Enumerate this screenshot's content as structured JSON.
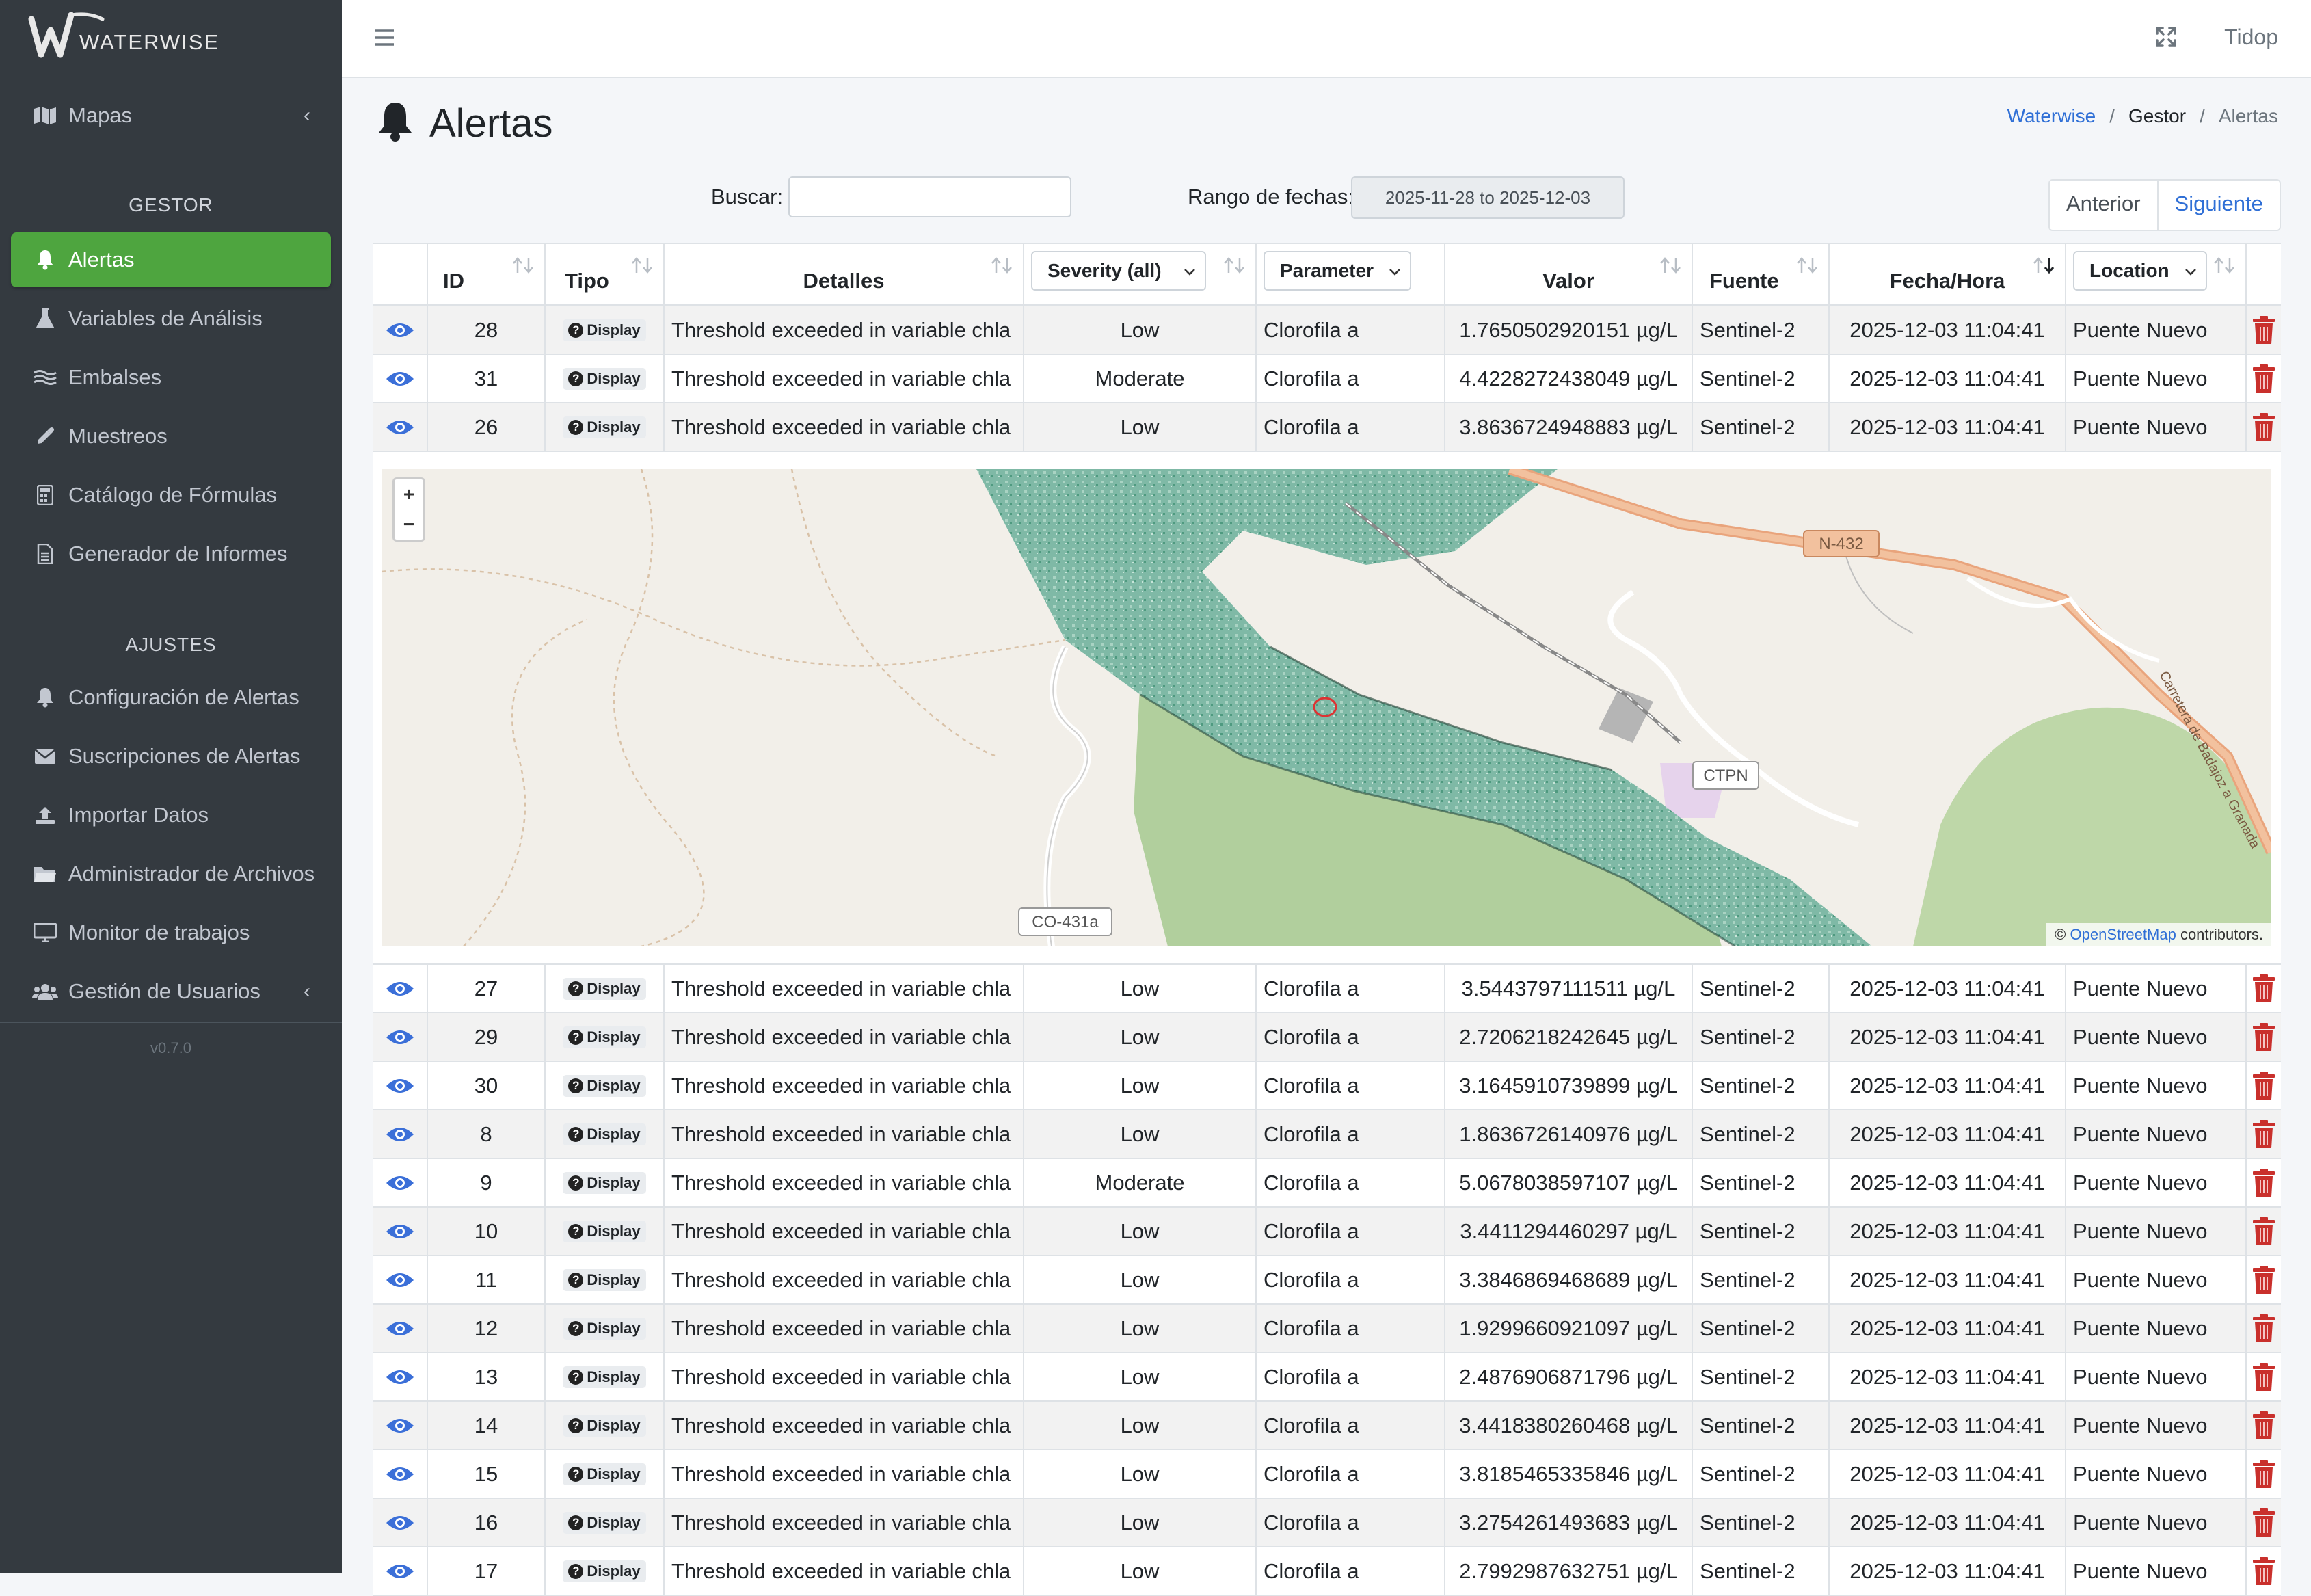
{
  "brand": {
    "logo_text": "WATERWISE"
  },
  "sidebar": {
    "sections": [
      {
        "header": "",
        "items": [
          {
            "label": "Mapas",
            "icon": "map-icon",
            "expandable": true
          }
        ]
      },
      {
        "header": "GESTOR",
        "items": [
          {
            "label": "Alertas",
            "icon": "bell-icon",
            "active": true
          },
          {
            "label": "Variables de Análisis",
            "icon": "flask-icon"
          },
          {
            "label": "Embalses",
            "icon": "water-icon"
          },
          {
            "label": "Muestreos",
            "icon": "eyedropper-icon"
          },
          {
            "label": "Catálogo de Fórmulas",
            "icon": "calculator-icon"
          },
          {
            "label": "Generador de Informes",
            "icon": "file-icon"
          }
        ]
      },
      {
        "header": "AJUSTES",
        "items": [
          {
            "label": "Configuración de Alertas",
            "icon": "bell-icon"
          },
          {
            "label": "Suscripciones de Alertas",
            "icon": "envelope-icon"
          },
          {
            "label": "Importar Datos",
            "icon": "upload-icon"
          },
          {
            "label": "Administrador de Archivos",
            "icon": "folder-icon"
          },
          {
            "label": "Monitor de trabajos",
            "icon": "monitor-icon"
          },
          {
            "label": "Gestión de Usuarios",
            "icon": "users-icon",
            "expandable": true
          }
        ]
      }
    ],
    "version": "v0.7.0"
  },
  "topbar": {
    "user": "Tidop"
  },
  "page": {
    "title": "Alertas",
    "breadcrumb": [
      "Waterwise",
      "Gestor",
      "Alertas"
    ]
  },
  "filters": {
    "search_label": "Buscar:",
    "search_value": "",
    "range_label": "Rango de fechas:",
    "range_value": "2025-11-28 to 2025-12-03"
  },
  "pagination": {
    "prev": "Anterior",
    "next": "Siguiente"
  },
  "table": {
    "headers": {
      "id": "ID",
      "tipo": "Tipo",
      "detalles": "Detalles",
      "severity": "Severity (all)",
      "parameter": "Parameter",
      "valor": "Valor",
      "fuente": "Fuente",
      "fecha": "Fecha/Hora",
      "location": "Location"
    },
    "badge_label": "Display",
    "rows_before_map": [
      {
        "id": "28",
        "detalles": "Threshold exceeded in variable chla",
        "severity": "Low",
        "parameter": "Clorofila a",
        "valor": "1.7650502920151 µg/L",
        "fuente": "Sentinel-2",
        "fecha": "2025-12-03 11:04:41",
        "location": "Puente Nuevo"
      },
      {
        "id": "31",
        "detalles": "Threshold exceeded in variable chla",
        "severity": "Moderate",
        "parameter": "Clorofila a",
        "valor": "4.4228272438049 µg/L",
        "fuente": "Sentinel-2",
        "fecha": "2025-12-03 11:04:41",
        "location": "Puente Nuevo"
      },
      {
        "id": "26",
        "detalles": "Threshold exceeded in variable chla",
        "severity": "Low",
        "parameter": "Clorofila a",
        "valor": "3.8636724948883 µg/L",
        "fuente": "Sentinel-2",
        "fecha": "2025-12-03 11:04:41",
        "location": "Puente Nuevo"
      }
    ],
    "rows_after_map": [
      {
        "id": "27",
        "detalles": "Threshold exceeded in variable chla",
        "severity": "Low",
        "parameter": "Clorofila a",
        "valor": "3.5443797111511 µg/L",
        "fuente": "Sentinel-2",
        "fecha": "2025-12-03 11:04:41",
        "location": "Puente Nuevo"
      },
      {
        "id": "29",
        "detalles": "Threshold exceeded in variable chla",
        "severity": "Low",
        "parameter": "Clorofila a",
        "valor": "2.7206218242645 µg/L",
        "fuente": "Sentinel-2",
        "fecha": "2025-12-03 11:04:41",
        "location": "Puente Nuevo"
      },
      {
        "id": "30",
        "detalles": "Threshold exceeded in variable chla",
        "severity": "Low",
        "parameter": "Clorofila a",
        "valor": "3.1645910739899 µg/L",
        "fuente": "Sentinel-2",
        "fecha": "2025-12-03 11:04:41",
        "location": "Puente Nuevo"
      },
      {
        "id": "8",
        "detalles": "Threshold exceeded in variable chla",
        "severity": "Low",
        "parameter": "Clorofila a",
        "valor": "1.8636726140976 µg/L",
        "fuente": "Sentinel-2",
        "fecha": "2025-12-03 11:04:41",
        "location": "Puente Nuevo"
      },
      {
        "id": "9",
        "detalles": "Threshold exceeded in variable chla",
        "severity": "Moderate",
        "parameter": "Clorofila a",
        "valor": "5.0678038597107 µg/L",
        "fuente": "Sentinel-2",
        "fecha": "2025-12-03 11:04:41",
        "location": "Puente Nuevo"
      },
      {
        "id": "10",
        "detalles": "Threshold exceeded in variable chla",
        "severity": "Low",
        "parameter": "Clorofila a",
        "valor": "3.4411294460297 µg/L",
        "fuente": "Sentinel-2",
        "fecha": "2025-12-03 11:04:41",
        "location": "Puente Nuevo"
      },
      {
        "id": "11",
        "detalles": "Threshold exceeded in variable chla",
        "severity": "Low",
        "parameter": "Clorofila a",
        "valor": "3.3846869468689 µg/L",
        "fuente": "Sentinel-2",
        "fecha": "2025-12-03 11:04:41",
        "location": "Puente Nuevo"
      },
      {
        "id": "12",
        "detalles": "Threshold exceeded in variable chla",
        "severity": "Low",
        "parameter": "Clorofila a",
        "valor": "1.9299660921097 µg/L",
        "fuente": "Sentinel-2",
        "fecha": "2025-12-03 11:04:41",
        "location": "Puente Nuevo"
      },
      {
        "id": "13",
        "detalles": "Threshold exceeded in variable chla",
        "severity": "Low",
        "parameter": "Clorofila a",
        "valor": "2.4876906871796 µg/L",
        "fuente": "Sentinel-2",
        "fecha": "2025-12-03 11:04:41",
        "location": "Puente Nuevo"
      },
      {
        "id": "14",
        "detalles": "Threshold exceeded in variable chla",
        "severity": "Low",
        "parameter": "Clorofila a",
        "valor": "3.4418380260468 µg/L",
        "fuente": "Sentinel-2",
        "fecha": "2025-12-03 11:04:41",
        "location": "Puente Nuevo"
      },
      {
        "id": "15",
        "detalles": "Threshold exceeded in variable chla",
        "severity": "Low",
        "parameter": "Clorofila a",
        "valor": "3.8185465335846 µg/L",
        "fuente": "Sentinel-2",
        "fecha": "2025-12-03 11:04:41",
        "location": "Puente Nuevo"
      },
      {
        "id": "16",
        "detalles": "Threshold exceeded in variable chla",
        "severity": "Low",
        "parameter": "Clorofila a",
        "valor": "3.2754261493683 µg/L",
        "fuente": "Sentinel-2",
        "fecha": "2025-12-03 11:04:41",
        "location": "Puente Nuevo"
      },
      {
        "id": "17",
        "detalles": "Threshold exceeded in variable chla",
        "severity": "Low",
        "parameter": "Clorofila a",
        "valor": "2.7992987632751 µg/L",
        "fuente": "Sentinel-2",
        "fecha": "2025-12-03 11:04:41",
        "location": "Puente Nuevo"
      }
    ]
  },
  "map": {
    "road_labels": [
      "N-432",
      "CO-431a",
      "Carretera de Badajoz a Granada"
    ],
    "place_labels": [
      "CTPN"
    ],
    "zoom_in": "+",
    "zoom_out": "−",
    "attribution_prefix": "©",
    "attribution_link": "OpenStreetMap",
    "attribution_suffix": "contributors."
  },
  "colors": {
    "accent": "#4ea53f",
    "link": "#2f6fd6",
    "danger": "#c9302c",
    "sidebar_bg": "#343a40"
  }
}
